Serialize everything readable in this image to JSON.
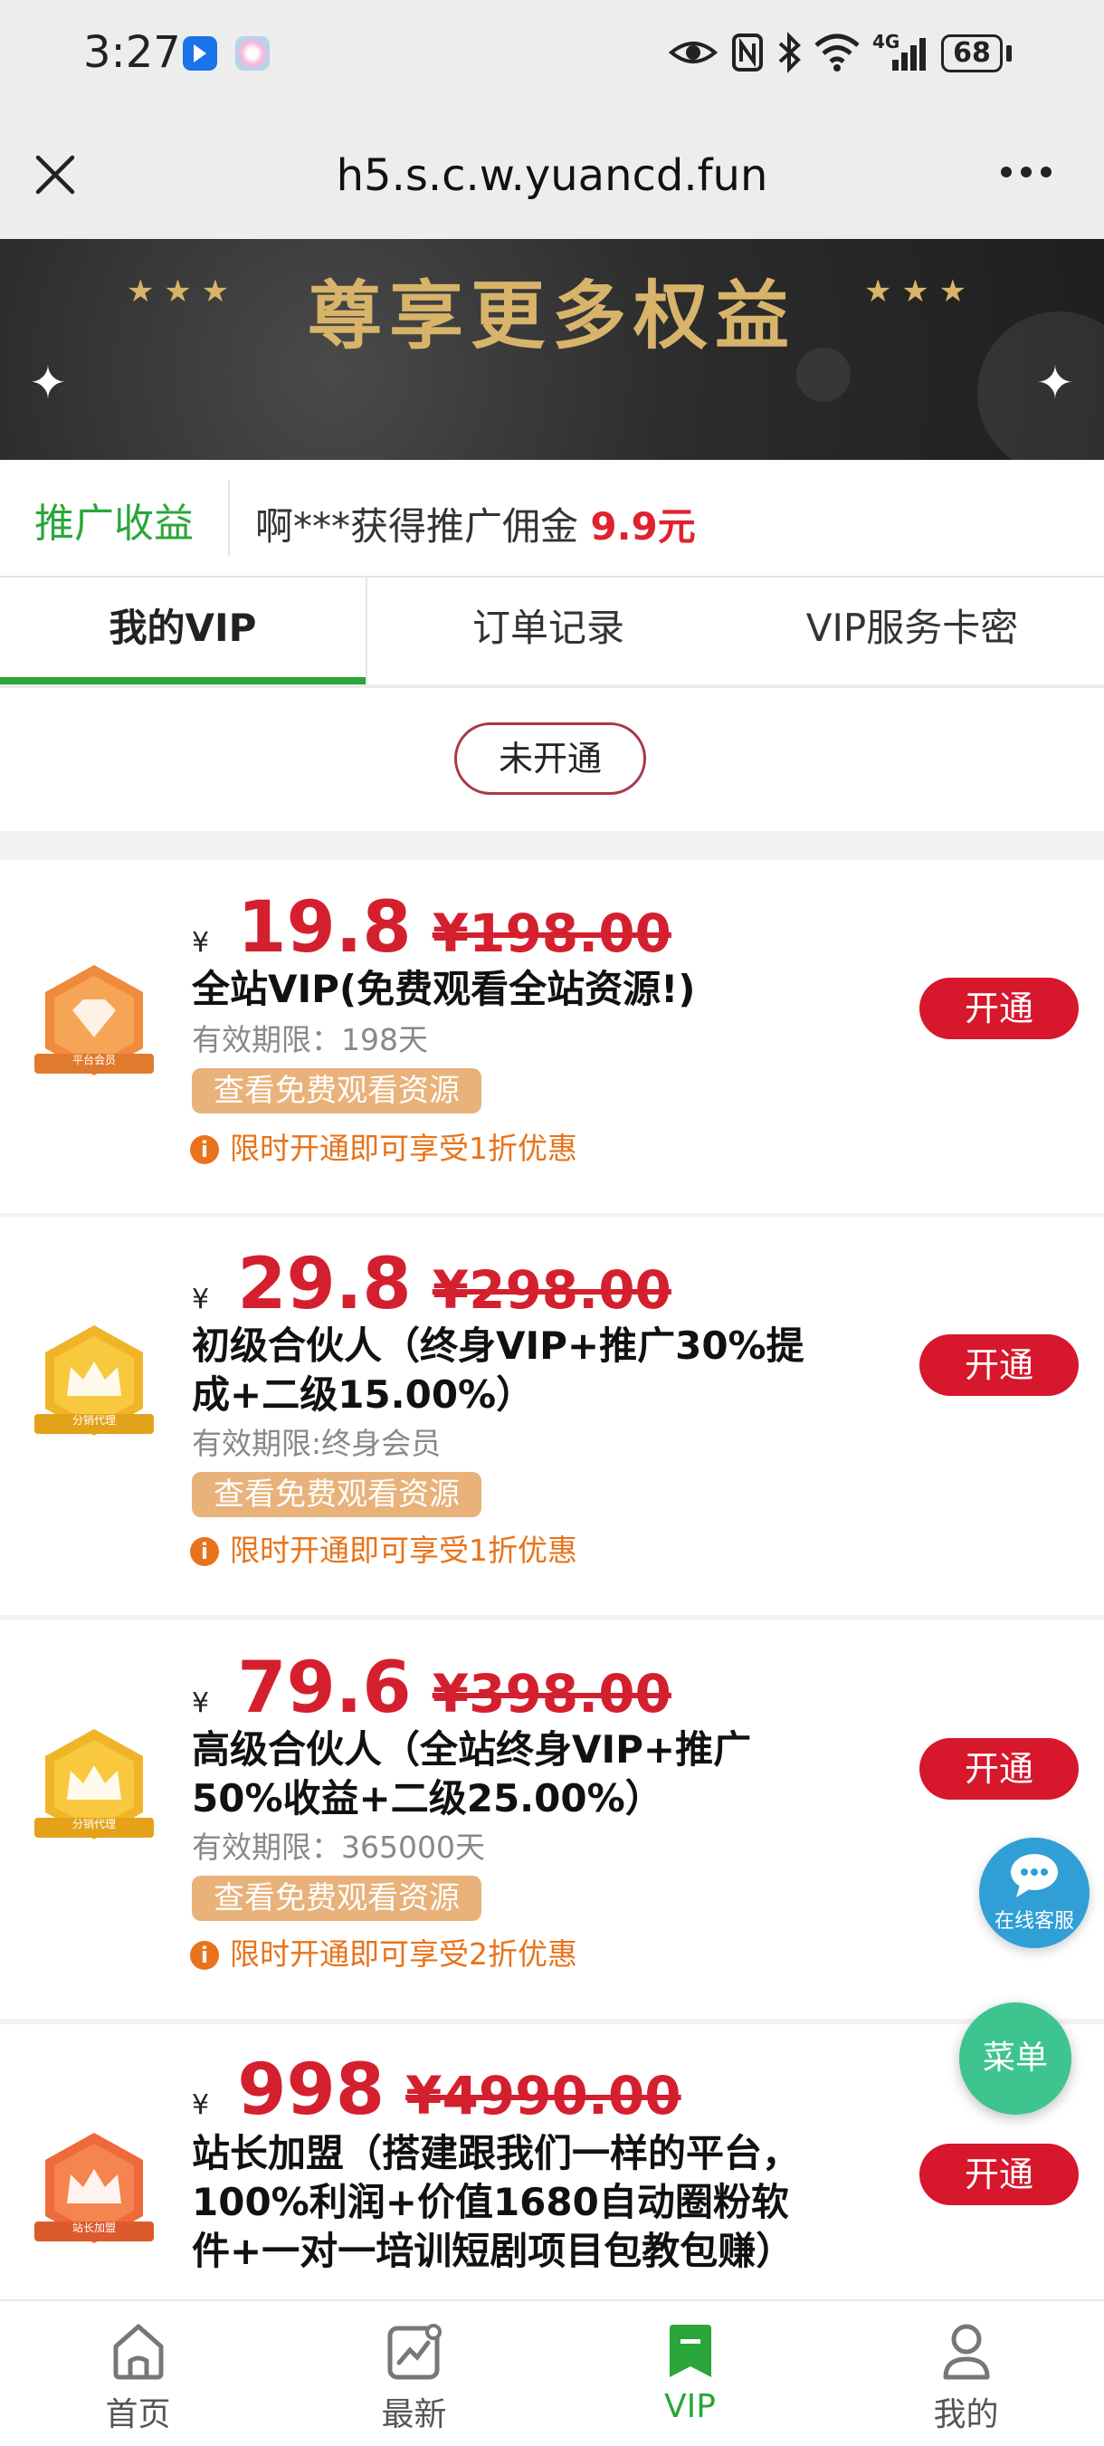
{
  "status_bar": {
    "time": "3:27",
    "battery": "68",
    "network": "4G"
  },
  "browser": {
    "url": "h5.s.c.w.yuancd.fun",
    "close_icon": "close-icon",
    "more_icon": "more-icon"
  },
  "banner": {
    "title": "尊享更多权益"
  },
  "promo": {
    "label": "推广收益",
    "text": "啊***获得推广佣金",
    "amount": "9.9元"
  },
  "tabs": [
    {
      "label": "我的VIP"
    },
    {
      "label": "订单记录"
    },
    {
      "label": "VIP服务卡密"
    }
  ],
  "status": {
    "label": "未开通"
  },
  "plans": [
    {
      "currency": "¥",
      "price": "19.8",
      "original": "¥198.00",
      "title": "全站VIP(免费观看全站资源!)",
      "validity": "有效期限：198天",
      "tag": "查看免费观看资源",
      "note": "限时开通即可享受1折优惠",
      "button": "开通",
      "badge_label": "平台会员"
    },
    {
      "currency": "¥",
      "price": "29.8",
      "original": "¥298.00",
      "title": "初级合伙人（终身VIP+推广30%提成+二级15.00%）",
      "validity": "有效期限:终身会员",
      "tag": "查看免费观看资源",
      "note": "限时开通即可享受1折优惠",
      "button": "开通",
      "badge_label": "分销代理"
    },
    {
      "currency": "¥",
      "price": "79.6",
      "original": "¥398.00",
      "title": "高级合伙人（全站终身VIP+推广50%收益+二级25.00%）",
      "validity": "有效期限：365000天",
      "tag": "查看免费观看资源",
      "note": "限时开通即可享受2折优惠",
      "button": "开通",
      "badge_label": "分销代理"
    },
    {
      "currency": "¥",
      "price": "998",
      "original": "¥4990.00",
      "title": "站长加盟（搭建跟我们一样的平台，100%利润+价值1680自动圈粉软件+一对一培训短剧项目包教包赚）",
      "button": "开通",
      "badge_label": "站长加盟"
    }
  ],
  "floating": {
    "service": "在线客服",
    "menu": "菜单"
  },
  "nav": [
    {
      "label": "首页"
    },
    {
      "label": "最新"
    },
    {
      "label": "VIP"
    },
    {
      "label": "我的"
    }
  ],
  "colors": {
    "accent_green": "#2aa63a",
    "price_red": "#d4202e",
    "button_red": "#d6172c",
    "tag_orange": "#e8b27a",
    "note_orange": "#e8731a"
  }
}
